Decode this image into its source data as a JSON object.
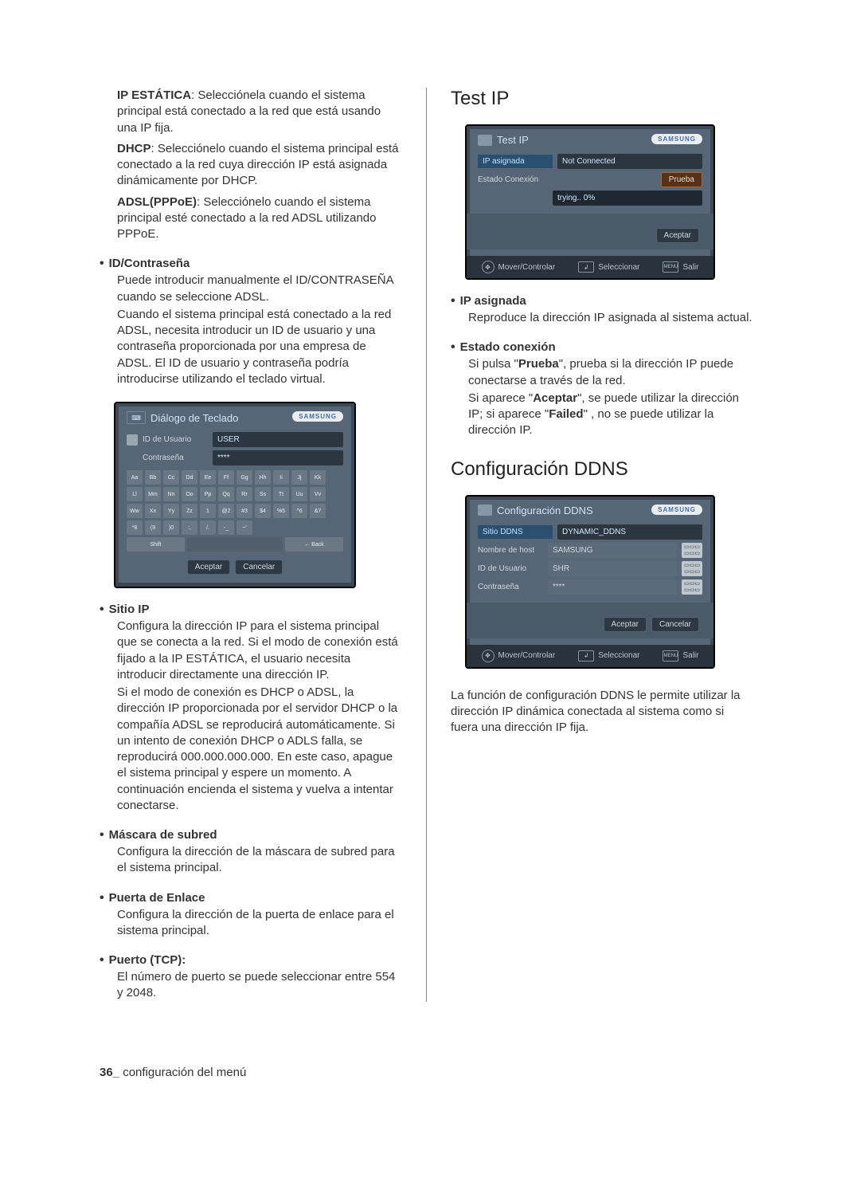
{
  "left": {
    "ip_estatica_label": "IP ESTÁTICA",
    "ip_estatica_body": ": Selecciónela cuando el sistema principal está conectado a la red que está usando una IP fija.",
    "dhcp_label": "DHCP",
    "dhcp_body": ": Selecciónelo cuando el sistema principal está conectado a la red cuya dirección IP está asignada dinámicamente por DHCP.",
    "adsl_label": "ADSL(PPPoE)",
    "adsl_body": ": Selecciónelo cuando el sistema principal esté conectado a la red ADSL utilizando PPPoE.",
    "id_section": "ID/Contraseña",
    "id_p1": "Puede introducir manualmente el ID/CONTRASEÑA cuando se seleccione ADSL.",
    "id_p2": "Cuando el sistema principal está conectado a la red ADSL, necesita introducir un ID de usuario y una contraseña proporcionada por una empresa de ADSL. El ID de usuario y contraseña podría introducirse utilizando el teclado virtual.",
    "sitio_section": "Sitio IP",
    "sitio_p1": "Configura la dirección IP para el sistema principal que se conecta a la red. Si el modo de conexión está fijado a la IP ESTÁTICA, el usuario necesita introducir directamente una dirección IP.",
    "sitio_p2": "Si el modo de conexión es DHCP o ADSL, la dirección IP proporcionada por el servidor DHCP o la compañía ADSL se reproducirá automáticamente. Si un intento de conexión DHCP o ADLS falla, se reproducirá 000.000.000.000. En este caso, apague el sistema principal y espere un momento. A continuación encienda el sistema y vuelva a intentar conectarse.",
    "mask_section": "Máscara de subred",
    "mask_p": "Configura la dirección de la máscara de subred para el sistema principal.",
    "gw_section": "Puerta de Enlace",
    "gw_p": "Configura la dirección de la puerta de enlace para el sistema principal.",
    "port_section": "Puerto (TCP):",
    "port_p": "El número de puerto se puede seleccionar entre 554 y 2048."
  },
  "right": {
    "testip_heading": "Test IP",
    "ip_asig_label": "IP asignada",
    "ip_asig_p": "Reproduce la dirección IP asignada al sistema actual.",
    "estado_label": "Estado conexión",
    "estado_p1a": "Si pulsa \"",
    "estado_p1b": "Prueba",
    "estado_p1c": "\", prueba si la dirección IP puede conectarse a través de la red.",
    "estado_p2a": "Si aparece \"",
    "estado_p2b": "Aceptar",
    "estado_p2c": "\", se puede utilizar la dirección IP; si aparece \"",
    "estado_p2d": "Failed",
    "estado_p2e": "\" , no se puede utilizar la dirección IP.",
    "ddns_heading": "Configuración DDNS",
    "ddns_p": "La función de configuración DDNS le permite utilizar la dirección IP dinámica conectada al sistema como si fuera una dirección IP fija."
  },
  "panels": {
    "kb": {
      "title": "Diálogo de Teclado",
      "logo": "SAMSUNG",
      "user_lbl": "ID de Usuario",
      "user_val": "USER",
      "pass_lbl": "Contraseña",
      "pass_val": "****",
      "shift": "Shift",
      "back": "← Back",
      "ok": "Aceptar",
      "cancel": "Cancelar",
      "keys": [
        "Aa",
        "Bb",
        "Cc",
        "Dd",
        "Ee",
        "Ff",
        "Gg",
        "Hh",
        "Ii",
        "Jj",
        "Kk",
        "Ll",
        "Mm",
        "Nn",
        "Oo",
        "Pp",
        "Qq",
        "Rr",
        "Ss",
        "Tt",
        "Uu",
        "Vv",
        "Ww",
        "Xx",
        "Yy",
        "Zz",
        "1",
        "@2",
        "#3",
        "$4",
        "%5",
        "^6",
        "&7",
        "*8",
        "(9",
        ")0",
        ":,",
        "/.",
        "-_",
        "~'"
      ]
    },
    "testip": {
      "title": "Test IP",
      "logo": "SAMSUNG",
      "row1": "IP asignada",
      "row1v": "Not Connected",
      "row2": "Estado Conexión",
      "row2btn": "Prueba",
      "status": "trying.. 0%",
      "ok": "Aceptar",
      "f1": "Mover/Controlar",
      "f2": "Seleccionar",
      "f3": "Salir",
      "f3pre": "MENU"
    },
    "ddns": {
      "title": "Configuración DDNS",
      "logo": "SAMSUNG",
      "r1": "Sitio DDNS",
      "r1v": "DYNAMIC_DDNS",
      "r2": "Nombre de host",
      "r2v": "SAMSUNG",
      "r3": "ID de Usuario",
      "r3v": "SHR",
      "r4": "Contraseña",
      "r4v": "****",
      "ok": "Aceptar",
      "cancel": "Cancelar",
      "f1": "Mover/Controlar",
      "f2": "Seleccionar",
      "f3": "Salir",
      "f3pre": "MENU"
    }
  },
  "footer": {
    "page": "36_",
    "label": " configuración del menú"
  }
}
